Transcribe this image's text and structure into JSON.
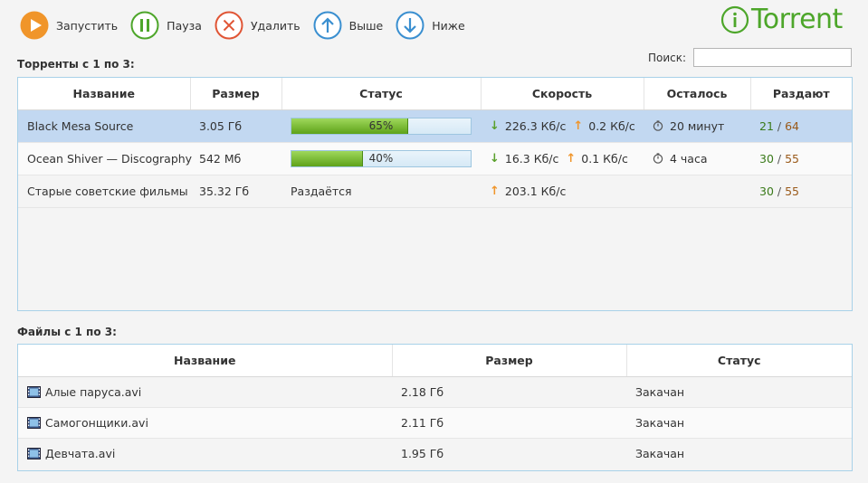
{
  "toolbar": {
    "start": "Запустить",
    "pause": "Пауза",
    "delete": "Удалить",
    "up": "Выше",
    "down": "Ниже"
  },
  "logo": {
    "text": "Torrent"
  },
  "search": {
    "label": "Поиск:",
    "value": ""
  },
  "torrents": {
    "title": "Торренты с 1 по 3:",
    "headers": {
      "name": "Название",
      "size": "Размер",
      "status": "Статус",
      "speed": "Скорость",
      "eta": "Осталось",
      "seeds": "Раздают"
    },
    "rows": [
      {
        "name": "Black Mesa Source",
        "size": "3.05 Гб",
        "progress": 0.65,
        "status": "65%",
        "down": "226.3 Кб/с",
        "up": "0.2 Кб/с",
        "eta": "20 минут",
        "seeds": "21",
        "slash": "/",
        "peers": "64"
      },
      {
        "name": "Ocean Shiver — Discography",
        "size": "542 Мб",
        "progress": 0.4,
        "status": "40%",
        "down": "16.3 Кб/с",
        "up": "0.1 Кб/с",
        "eta": "4 часа",
        "seeds": "30",
        "slash": "/",
        "peers": "55"
      },
      {
        "name": "Старые советские фильмы",
        "size": "35.32 Гб",
        "status": "Раздаётся",
        "up": "203.1 Кб/с",
        "seeds": "30",
        "slash": "/",
        "peers": "55"
      }
    ]
  },
  "files": {
    "title": "Файлы с 1 по 3:",
    "headers": {
      "name": "Название",
      "size": "Размер",
      "status": "Статус"
    },
    "rows": [
      {
        "name": "Алые паруса.avi",
        "size": "2.18 Гб",
        "status": "Закачан"
      },
      {
        "name": "Самогонщики.avi",
        "size": "2.11 Гб",
        "status": "Закачан"
      },
      {
        "name": "Девчата.avi",
        "size": "1.95 Гб",
        "status": "Закачан"
      }
    ]
  },
  "icons": {
    "start": "play-icon",
    "pause": "pause-icon",
    "delete": "delete-icon",
    "up": "arrow-up-icon",
    "down": "arrow-down-icon",
    "file": "film-file-icon",
    "download": "download-arrow-icon",
    "upload": "upload-arrow-icon",
    "eta": "stopwatch-icon"
  },
  "colors": {
    "start": "#f0952a",
    "pause": "#4da62a",
    "delete": "#e05535",
    "move": "#3a8fd0",
    "brand": "#4da62a",
    "selected_row": "#c2d8f1"
  }
}
